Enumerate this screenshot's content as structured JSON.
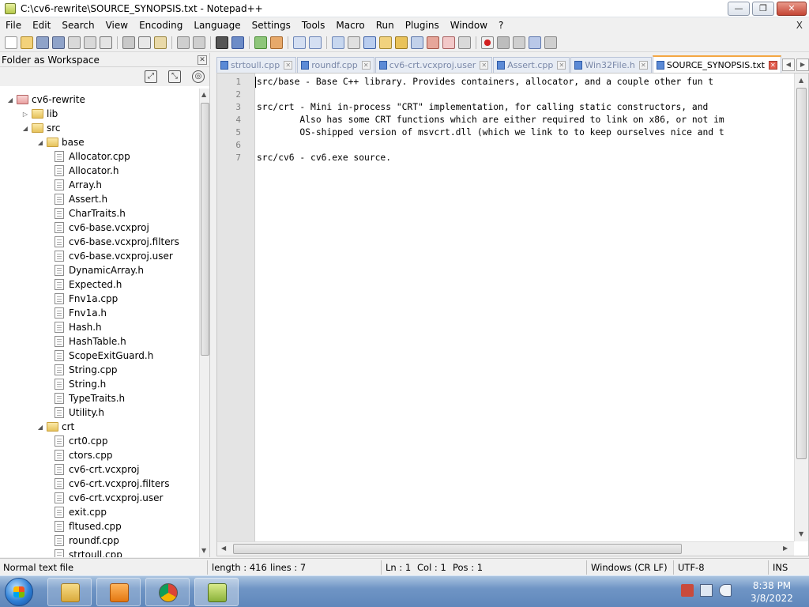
{
  "window": {
    "title": "C:\\cv6-rewrite\\SOURCE_SYNOPSIS.txt - Notepad++"
  },
  "menu": [
    "File",
    "Edit",
    "Search",
    "View",
    "Encoding",
    "Language",
    "Settings",
    "Tools",
    "Macro",
    "Run",
    "Plugins",
    "Window",
    "?"
  ],
  "menu_close": "X",
  "panel": {
    "title": "Folder as Workspace"
  },
  "tree": {
    "root": "cv6-rewrite",
    "lib": "lib",
    "src": "src",
    "base": "base",
    "base_files": [
      "Allocator.cpp",
      "Allocator.h",
      "Array.h",
      "Assert.h",
      "CharTraits.h",
      "cv6-base.vcxproj",
      "cv6-base.vcxproj.filters",
      "cv6-base.vcxproj.user",
      "DynamicArray.h",
      "Expected.h",
      "Fnv1a.cpp",
      "Fnv1a.h",
      "Hash.h",
      "HashTable.h",
      "ScopeExitGuard.h",
      "String.cpp",
      "String.h",
      "TypeTraits.h",
      "Utility.h"
    ],
    "crt": "crt",
    "crt_files": [
      "crt0.cpp",
      "ctors.cpp",
      "cv6-crt.vcxproj",
      "cv6-crt.vcxproj.filters",
      "cv6-crt.vcxproj.user",
      "exit.cpp",
      "fltused.cpp",
      "roundf.cpp",
      "strtoull.cpp"
    ]
  },
  "tabs": [
    "strtoull.cpp",
    "roundf.cpp",
    "cv6-crt.vcxproj.user",
    "Assert.cpp",
    "Win32File.h",
    "SOURCE_SYNOPSIS.txt"
  ],
  "active_tab": "SOURCE_SYNOPSIS.txt",
  "editor": {
    "line_numbers": [
      "1",
      "2",
      "3",
      "4",
      "5",
      "6",
      "7"
    ],
    "lines": [
      "src/base - Base C++ library. Provides containers, allocator, and a couple other fun t",
      "",
      "src/crt - Mini in-process \"CRT\" implementation, for calling static constructors, and",
      "        Also has some CRT functions which are either required to link on x86, or not im",
      "        OS-shipped version of msvcrt.dll (which we link to to keep ourselves nice and t",
      "",
      "src/cv6 - cv6.exe source."
    ]
  },
  "status": {
    "file_type": "Normal text file",
    "length": "length : 416",
    "lines": "lines : 7",
    "ln": "Ln : 1",
    "col": "Col : 1",
    "pos": "Pos : 1",
    "eol": "Windows (CR LF)",
    "encoding": "UTF-8",
    "mode": "INS"
  },
  "clock": {
    "time": "8:38 PM",
    "date": "3/8/2022"
  }
}
